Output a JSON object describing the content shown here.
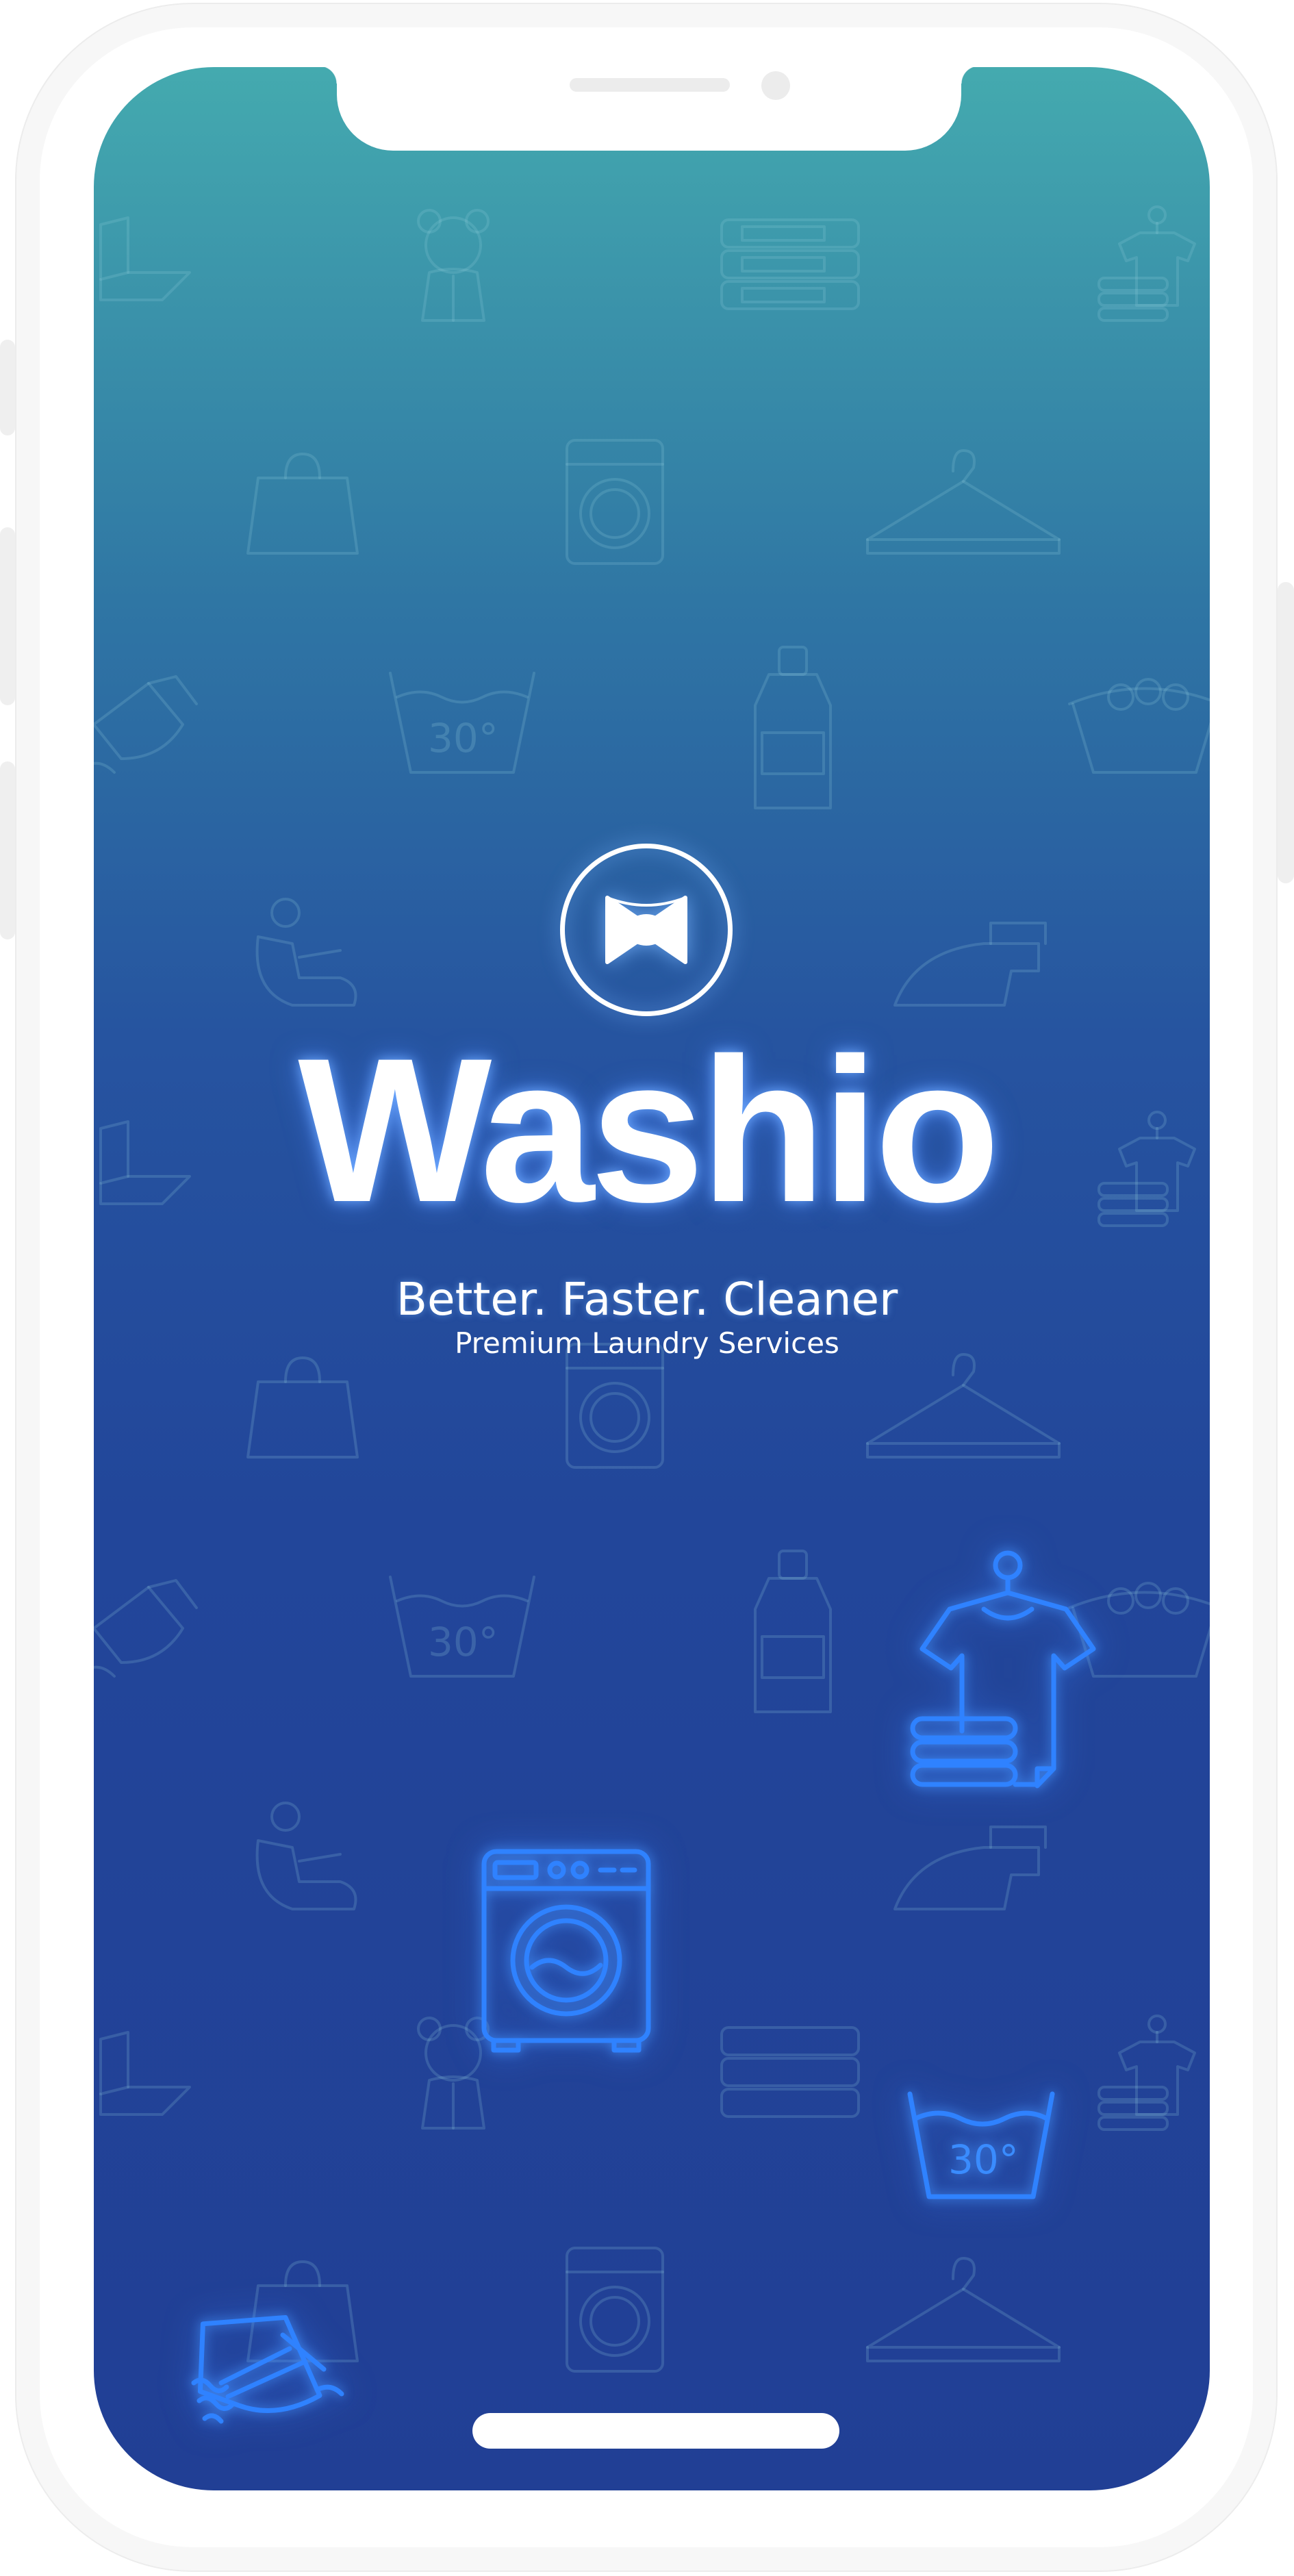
{
  "app": {
    "brand_name": "Washio",
    "tagline": "Better. Faster. Cleaner",
    "subtagline": "Premium Laundry Services"
  },
  "icons": {
    "logo": "bow-tie-icon",
    "background_pattern": [
      "t-shirt-icon",
      "teddy-bear-icon",
      "folded-towels-icon",
      "laundry-bag-icon",
      "washing-machine-icon",
      "clothes-hanger-icon",
      "iron-icon",
      "wash-30-degrees-icon",
      "detergent-bottle-icon",
      "laundry-basket-icon",
      "car-seat-icon"
    ],
    "highlighted": [
      "t-shirt-stack-icon",
      "washing-machine-icon",
      "wash-30-degrees-icon",
      "iron-icon"
    ],
    "wash_temperature_label": "30°"
  },
  "colors": {
    "gradient_top": "#44aaaf",
    "gradient_bottom": "#213f95",
    "glow_blue": "#2f82ff",
    "text": "#ffffff",
    "frame": "#ffffff"
  }
}
